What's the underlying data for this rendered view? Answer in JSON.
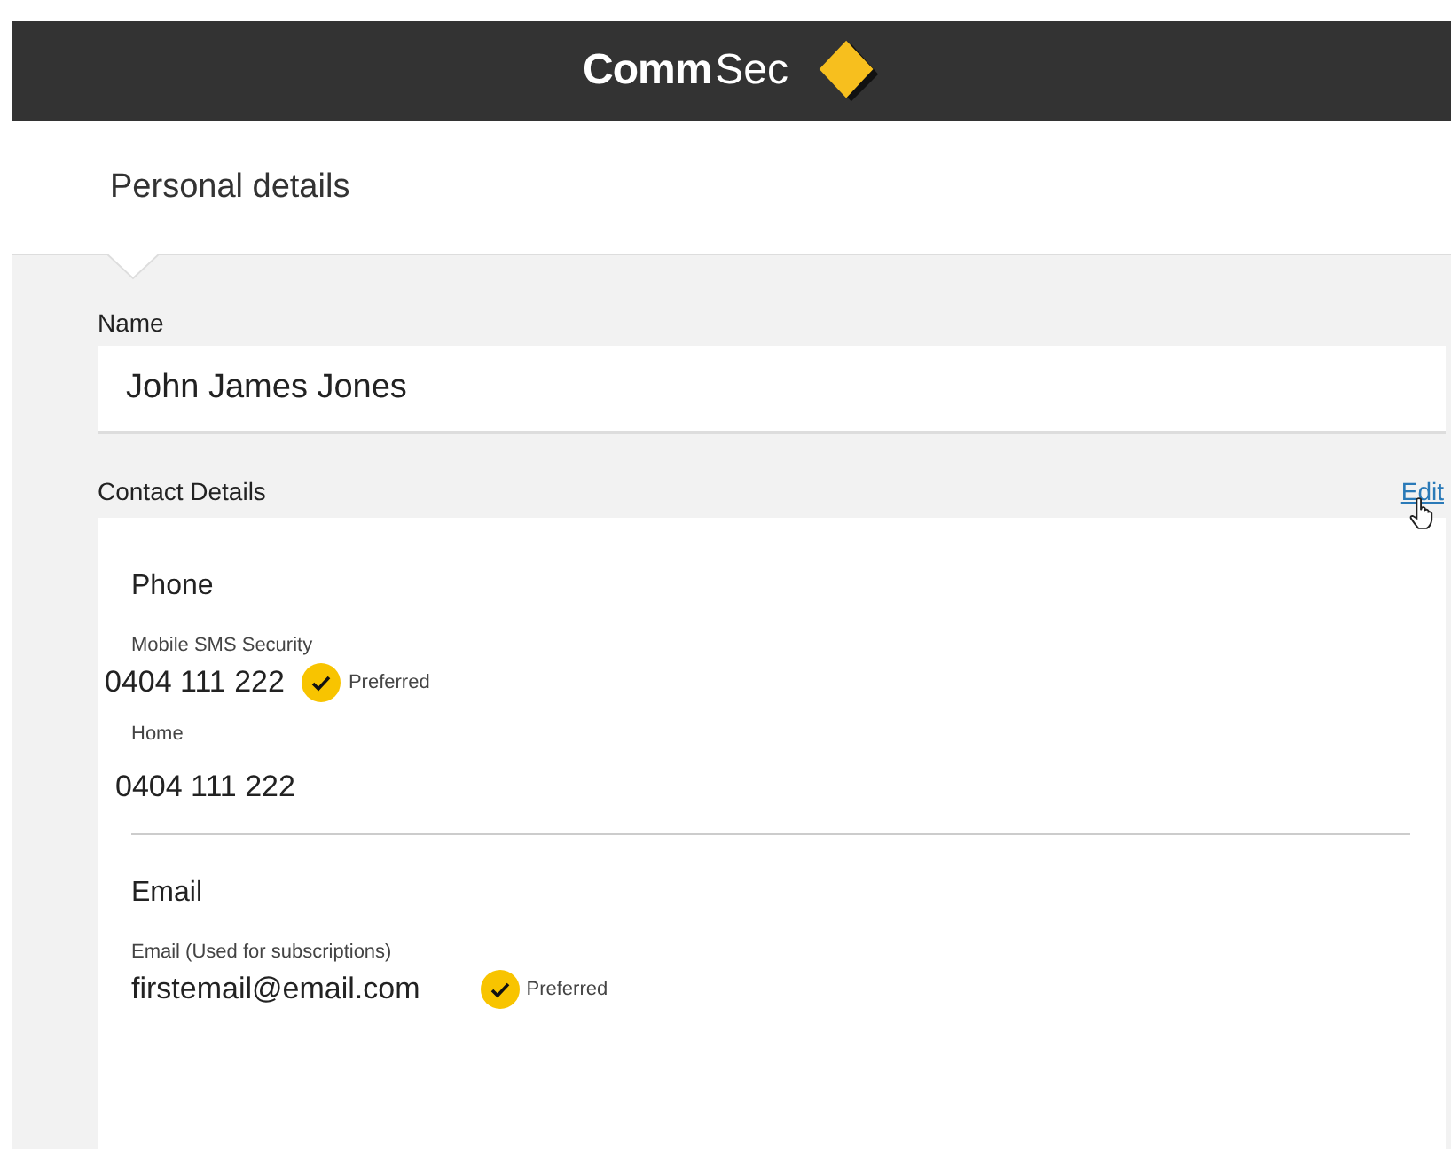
{
  "header": {
    "logo_bold": "Comm",
    "logo_light": "Sec"
  },
  "page_title": "Personal details",
  "name": {
    "label": "Name",
    "value": "John James Jones"
  },
  "contact": {
    "title": "Contact Details",
    "edit_link": "Edit",
    "groups": [
      {
        "title": "Phone",
        "items": [
          {
            "label": "Mobile SMS Security",
            "value": "0404 111 222",
            "preferred": true,
            "badge": "Preferred"
          },
          {
            "label": "Home",
            "value": "0404 111 222",
            "preferred": false
          }
        ]
      },
      {
        "title": "Email",
        "items": [
          {
            "label": "Email (Used for subscriptions)",
            "value": "firstemail@email.com",
            "preferred": true,
            "badge": "Preferred"
          }
        ]
      }
    ]
  }
}
